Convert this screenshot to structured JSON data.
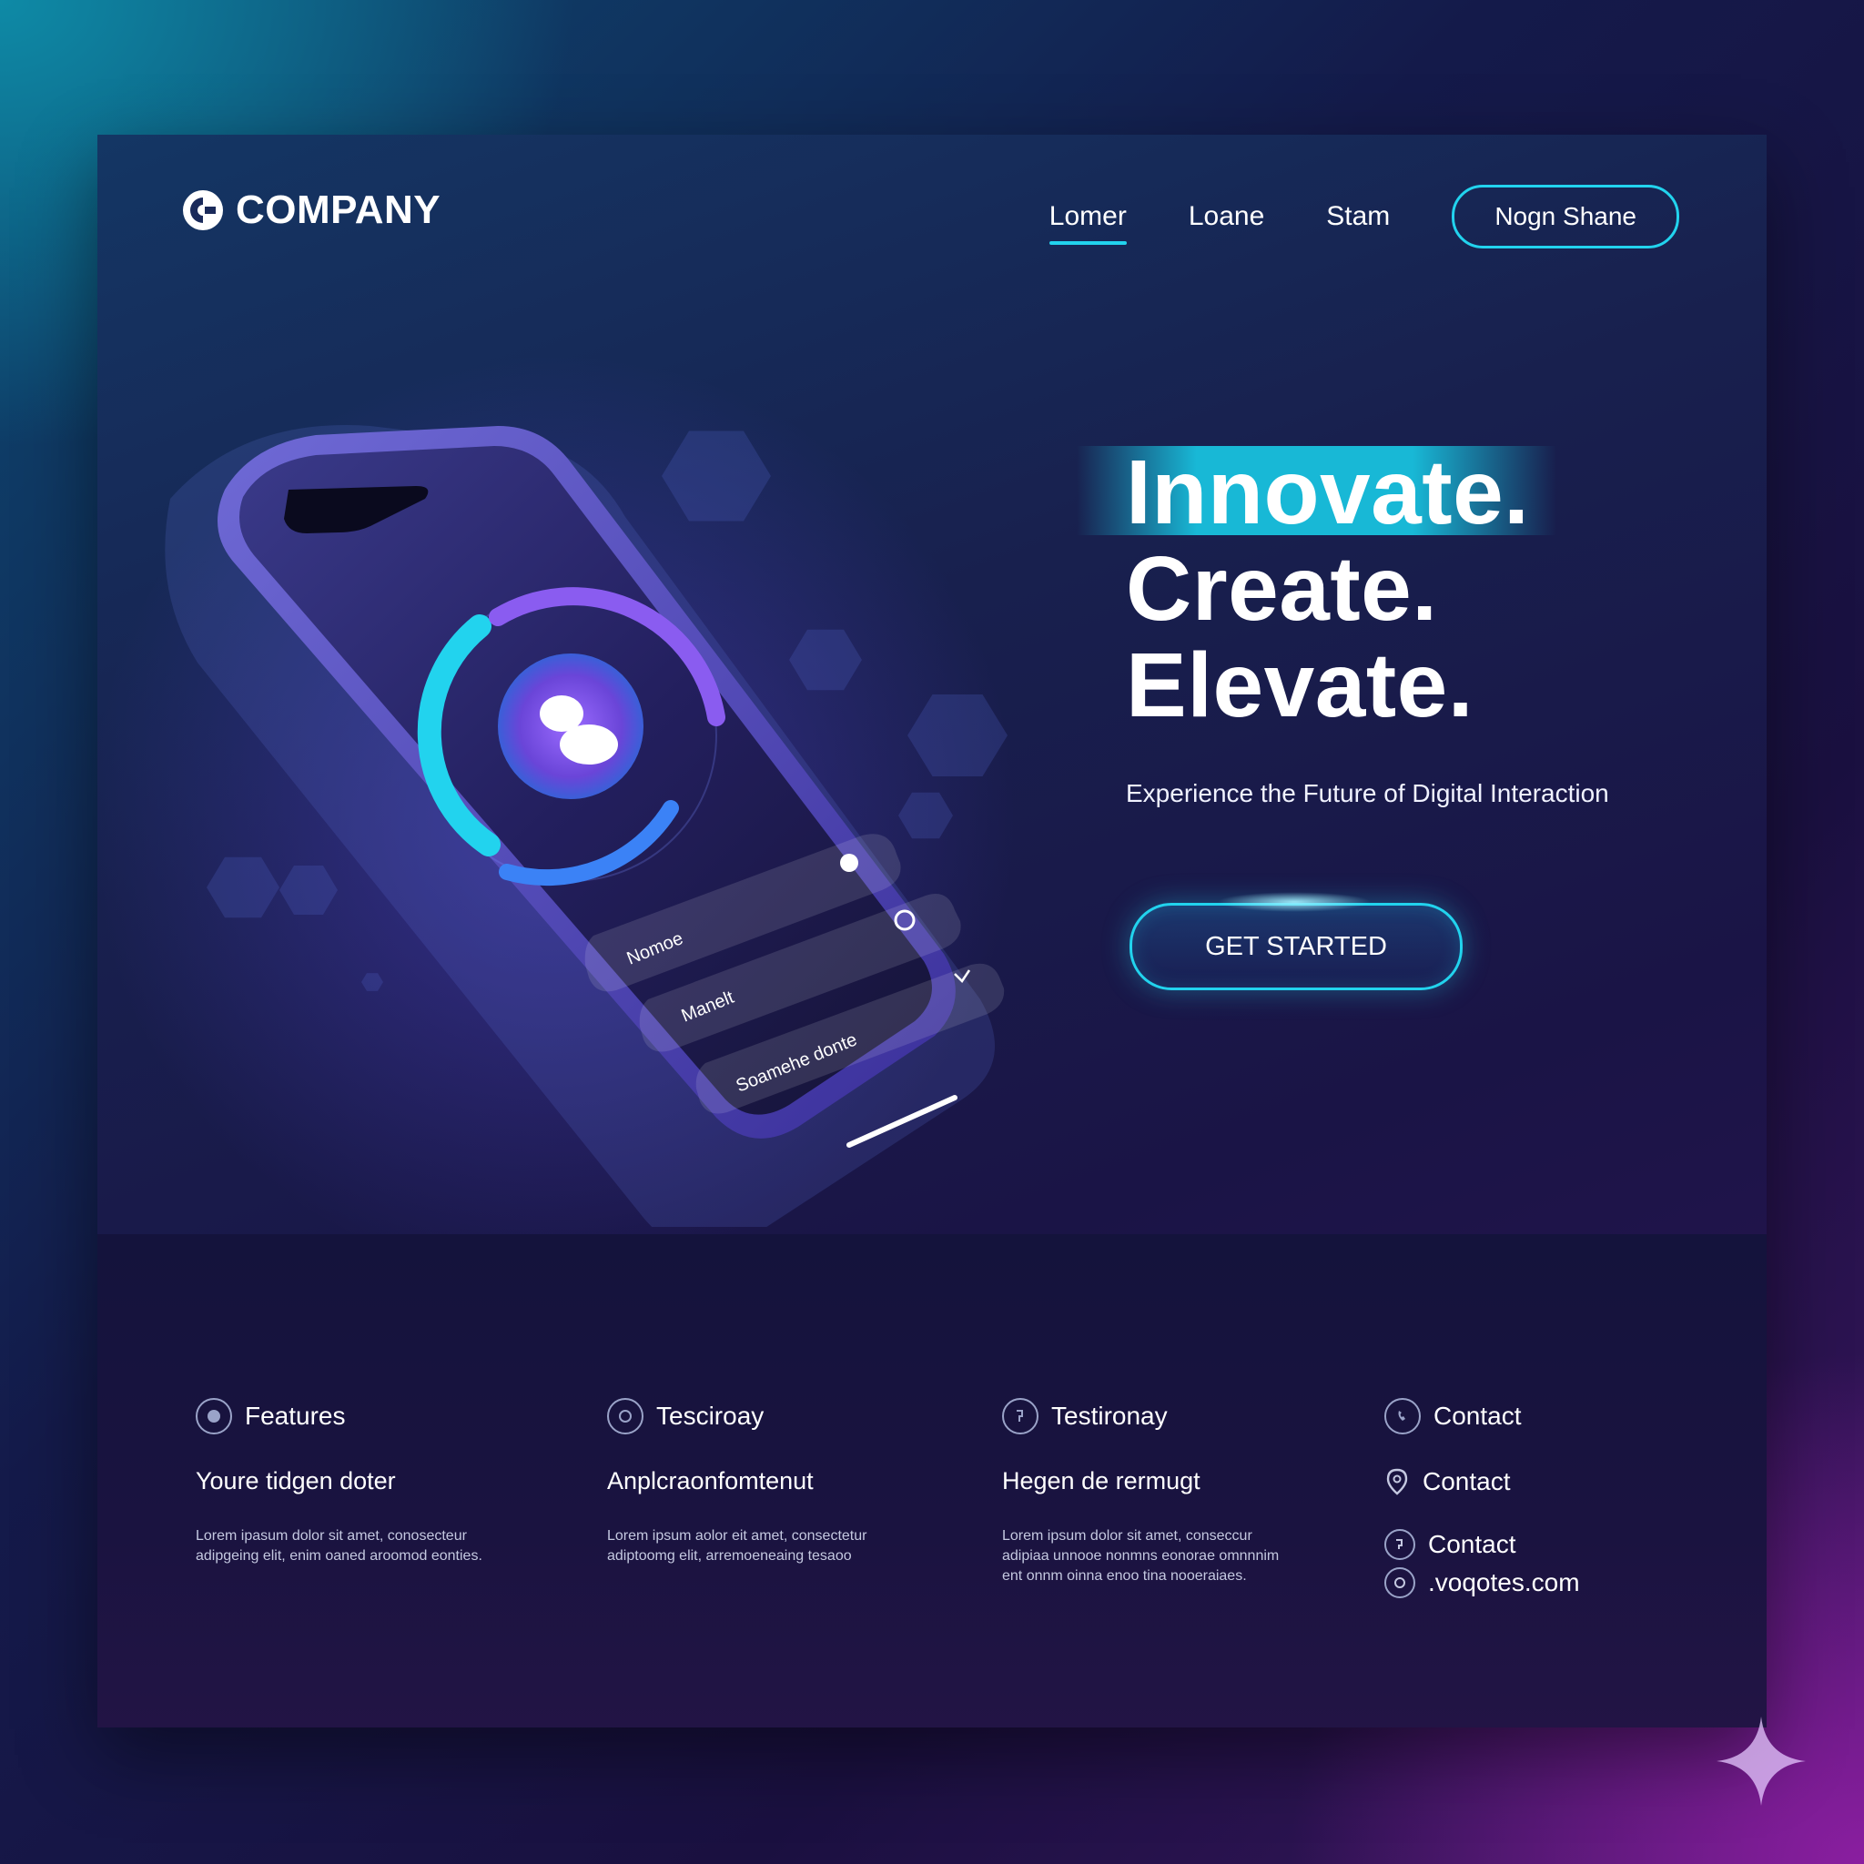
{
  "header": {
    "logo_text": "COMPANY",
    "nav": [
      {
        "label": "Lomer",
        "active": true
      },
      {
        "label": "Loane",
        "active": false
      },
      {
        "label": "Stam",
        "active": false
      }
    ],
    "cta_pill": "Nogn Shane"
  },
  "phone": {
    "rows": [
      "Nomoe",
      "Manelt",
      "Soamehe donte"
    ]
  },
  "hero": {
    "line1": "Innovate.",
    "line2": "Create.",
    "line3": "Elevate.",
    "subtitle": "Experience the Future of Digital Interaction",
    "cta": "GET STARTED"
  },
  "footer": {
    "columns": [
      {
        "heading": "Features",
        "subheading": "Youre tidgen doter",
        "body": "Lorem ipasum dolor sit amet, conosecteur adipgeing elit, enim oaned aroomod eonties."
      },
      {
        "heading": "Tesciroay",
        "subheading": "Anplcraonfomtenut",
        "body": "Lorem ipsum aolor eit amet, consectetur adiptoomg elit, arremoeneaing tesaoo"
      },
      {
        "heading": "Testironay",
        "subheading": "Hegen de rermugt",
        "body": "Lorem ipsum dolor sit amet, conseccur adipiaa unnooe nonmns eonorae omnnnim ent onnm oinna enoo tina nooeraiaes."
      }
    ],
    "contact": {
      "heading": "Contact",
      "items": [
        "Contact",
        "Contact",
        ".voqotes.com"
      ]
    }
  },
  "colors": {
    "accent": "#22d3ee",
    "purple": "#7b5cf0",
    "bg_dark": "#14133c"
  }
}
